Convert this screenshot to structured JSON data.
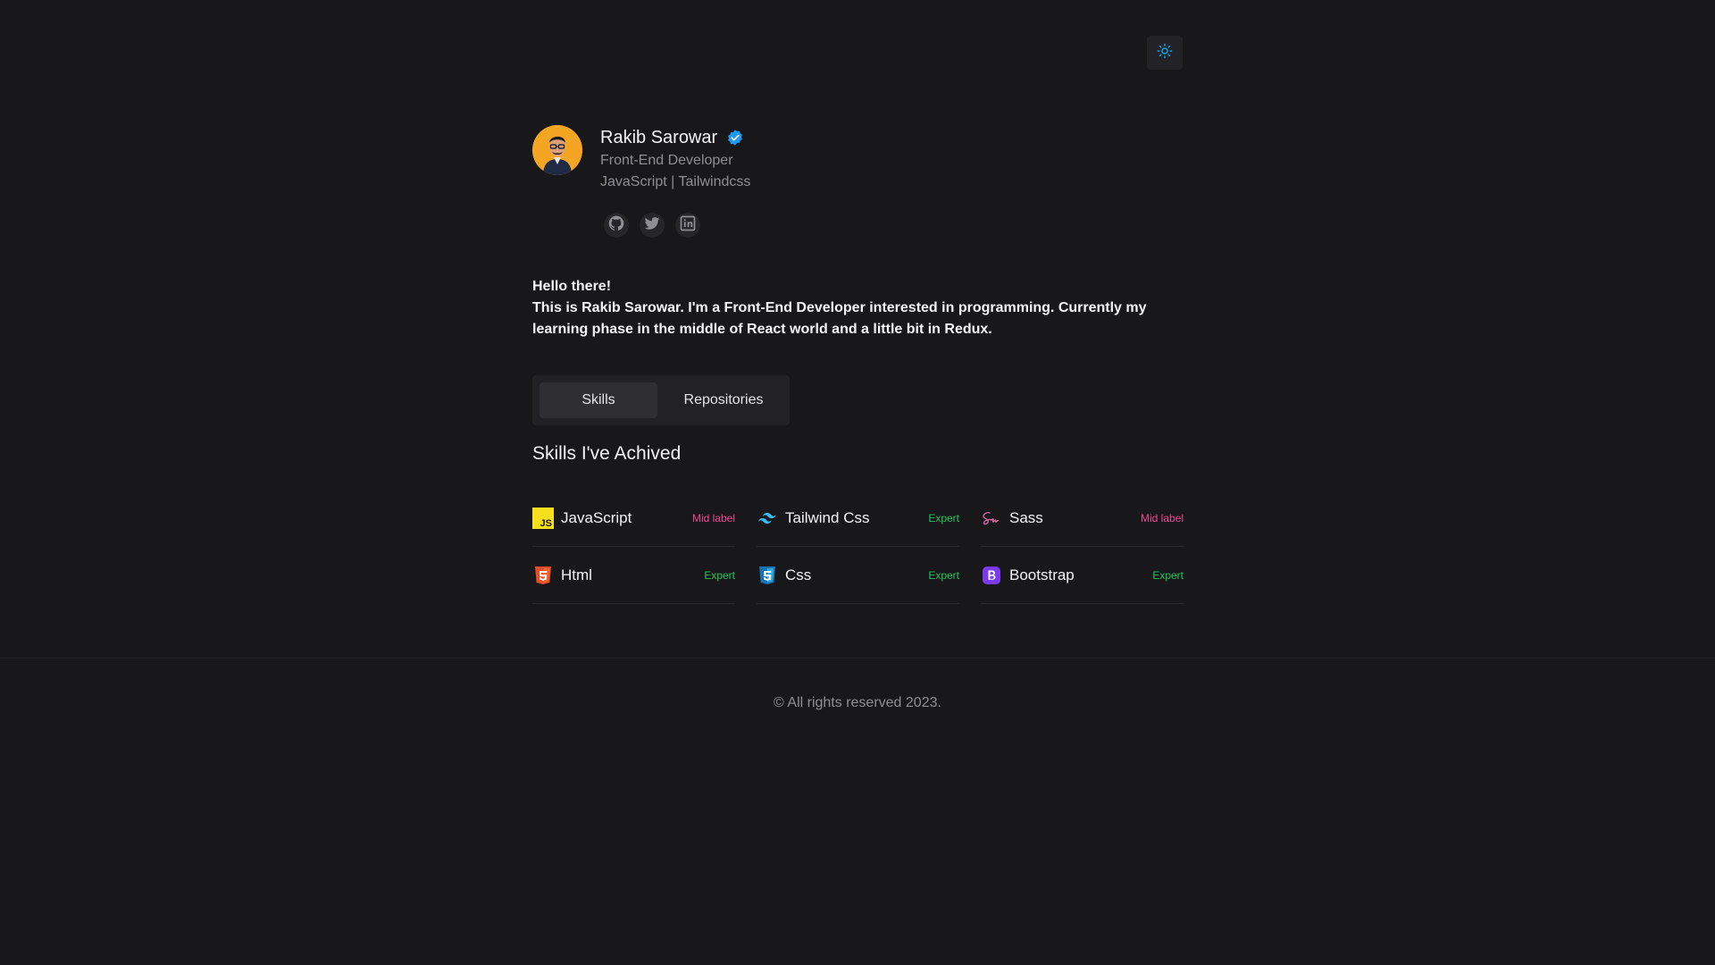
{
  "header": {
    "theme_toggle_icon": "sun-icon",
    "accent": "#0ea5e9"
  },
  "profile": {
    "name": "Rakib Sarowar",
    "verified_icon": "verified-badge-icon",
    "title": "Front-End Developer",
    "stack": "JavaScript | Tailwindcss",
    "socials": [
      {
        "icon": "github-icon"
      },
      {
        "icon": "twitter-icon"
      },
      {
        "icon": "linkedin-icon"
      }
    ]
  },
  "about": {
    "greeting": "Hello there!",
    "body": "This is Rakib Sarowar. I'm a Front-End Developer interested in programming. Currently my learning phase in the middle of React world and a little bit in Redux."
  },
  "tabs": [
    {
      "label": "Skills",
      "active": true
    },
    {
      "label": "Repositories",
      "active": false
    }
  ],
  "skills_section": {
    "title": "Skills I've Achived",
    "items": [
      {
        "name": "JavaScript",
        "level": "Mid label",
        "icon": "javascript-icon"
      },
      {
        "name": "Tailwind Css",
        "level": "Expert",
        "icon": "tailwind-icon"
      },
      {
        "name": "Sass",
        "level": "Mid label",
        "icon": "sass-icon"
      },
      {
        "name": "Html",
        "level": "Expert",
        "icon": "html5-icon"
      },
      {
        "name": "Css",
        "level": "Expert",
        "icon": "css3-icon"
      },
      {
        "name": "Bootstrap",
        "level": "Expert",
        "icon": "bootstrap-icon"
      }
    ],
    "colors": {
      "mid": "#ec4899",
      "expert": "#22c55e"
    }
  },
  "footer": {
    "text": "© All rights reserved 2023."
  }
}
